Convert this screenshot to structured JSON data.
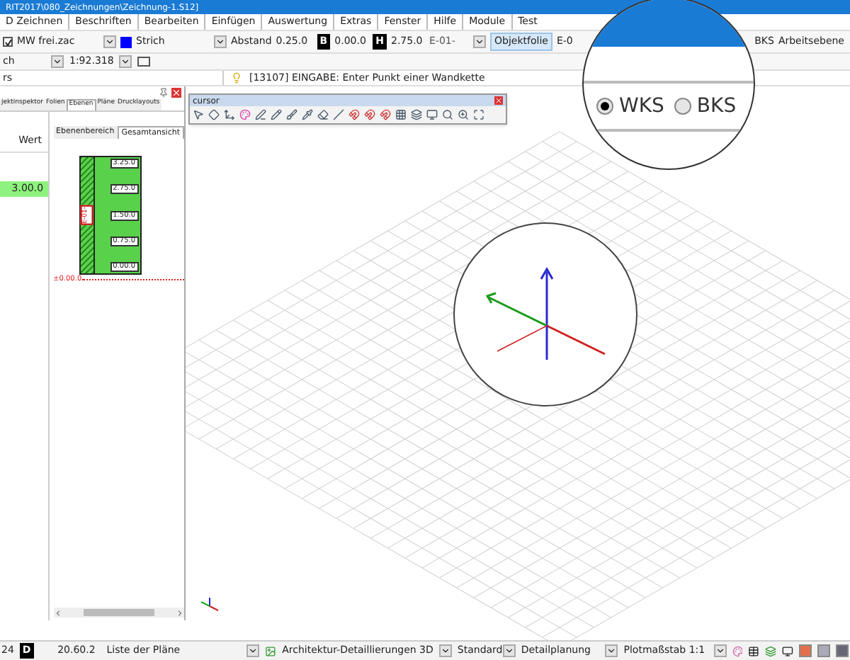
{
  "window": {
    "title": "RIT2017\\080_Zeichnungen\\Zeichnung-1.S12]"
  },
  "menu": [
    "D Zeichnen",
    "Beschriften",
    "Bearbeiten",
    "Einfügen",
    "Auswertung",
    "Extras",
    "Fenster",
    "Hilfe",
    "Module",
    "Test"
  ],
  "toolbar": {
    "layer_checked": true,
    "layer": "MW frei.zac",
    "line_style": "Strich",
    "spacing_label": "Abstand",
    "spacing": "0.25.0",
    "b_key": "B",
    "b_value": "0.00.0",
    "h_key": "H",
    "h_value": "2.75.0",
    "story": "E-01-",
    "object_layer": "Objektfolie",
    "story_2": "E-0",
    "bks": "BKS",
    "work_plane": "Arbeitsebene"
  },
  "toolbar_2": {
    "field": "ch",
    "scale": "1:92.318"
  },
  "command_line": {
    "field": "rs",
    "prompt": "[13107] EINGABE: Enter Punkt einer Wandkette"
  },
  "left_panel": {
    "tabs": [
      {
        "label": "jektinspektor",
        "selected": false
      },
      {
        "label": "Folien",
        "selected": false
      },
      {
        "label": "Ebenen",
        "selected": true
      },
      {
        "label": "Pläne",
        "selected": false
      },
      {
        "label": "Drucklayouts",
        "selected": false
      }
    ],
    "column": "Wert",
    "value": "3.00.0",
    "sub_tabs": [
      {
        "label": "Ebenenbereich",
        "selected": false
      },
      {
        "label": "Gesamtansicht",
        "selected": true
      }
    ],
    "storey_labels": [
      "3.25.0",
      "2.75.0",
      "1.50.0",
      "0.75.0",
      "0.00.0"
    ],
    "story_tag": "E-01-",
    "ground": "±0.00.0"
  },
  "cursor_toolbar": {
    "title": "cursor"
  },
  "magnifier": {
    "options": [
      {
        "label": "WKS",
        "selected": true
      },
      {
        "label": "BKS",
        "selected": false
      }
    ]
  },
  "status_bar": {
    "number": "24",
    "d_key": "D",
    "coordinate": "20.60.2",
    "plans": "Liste der Pläne",
    "detail": "Architektur-Detaillierungen  3D",
    "style": "Standard",
    "planning": "Detailplanung",
    "plot_scale": "Plotmaßstab  1:1"
  }
}
